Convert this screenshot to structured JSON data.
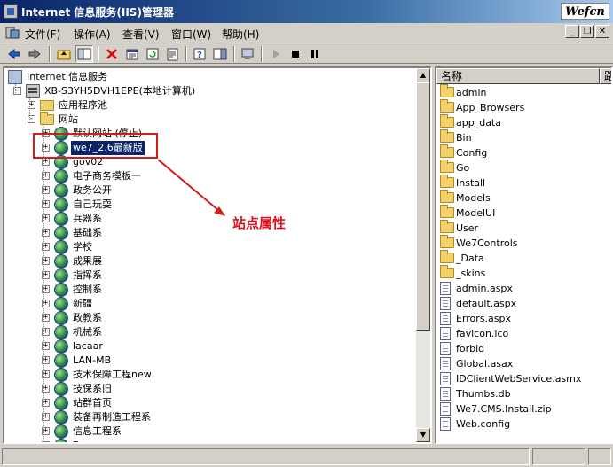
{
  "window": {
    "title": "Internet 信息服务(IIS)管理器",
    "watermark": "Wefcn"
  },
  "menu": [
    {
      "label": "文件(F)"
    },
    {
      "label": "操作(A)"
    },
    {
      "label": "查看(V)"
    },
    {
      "label": "窗口(W)"
    },
    {
      "label": "帮助(H)"
    }
  ],
  "tree": {
    "root": "Internet 信息服务",
    "server": "XB-S3YH5DVH1EPE(本地计算机)",
    "app_pools": "应用程序池",
    "websites": "网站",
    "sites": [
      {
        "label": "默认网站 (停止)"
      },
      {
        "label": "we7_2.6最新版"
      },
      {
        "label": "gov02"
      },
      {
        "label": "电子商务模板一"
      },
      {
        "label": "政务公开"
      },
      {
        "label": "自己玩耍"
      },
      {
        "label": "兵器系"
      },
      {
        "label": "基础系"
      },
      {
        "label": "学校"
      },
      {
        "label": "成果展"
      },
      {
        "label": "指挥系"
      },
      {
        "label": "控制系"
      },
      {
        "label": "新疆"
      },
      {
        "label": "政教系"
      },
      {
        "label": "机械系"
      },
      {
        "label": "lacaar"
      },
      {
        "label": "LAN-MB"
      },
      {
        "label": "技术保障工程new"
      },
      {
        "label": "技保系旧"
      },
      {
        "label": "站群首页"
      },
      {
        "label": "装备再制造工程系"
      },
      {
        "label": "信息工程系"
      },
      {
        "label": "Bona"
      }
    ]
  },
  "list": {
    "columns": [
      "名称",
      "路"
    ],
    "items": [
      {
        "name": "admin",
        "kind": "folder"
      },
      {
        "name": "App_Browsers",
        "kind": "folder"
      },
      {
        "name": "app_data",
        "kind": "folder"
      },
      {
        "name": "Bin",
        "kind": "folder"
      },
      {
        "name": "Config",
        "kind": "folder"
      },
      {
        "name": "Go",
        "kind": "folder"
      },
      {
        "name": "Install",
        "kind": "folder"
      },
      {
        "name": "Models",
        "kind": "folder"
      },
      {
        "name": "ModelUI",
        "kind": "folder"
      },
      {
        "name": "User",
        "kind": "folder"
      },
      {
        "name": "We7Controls",
        "kind": "folder"
      },
      {
        "name": "_Data",
        "kind": "folder"
      },
      {
        "name": "_skins",
        "kind": "folder"
      },
      {
        "name": "admin.aspx",
        "kind": "file"
      },
      {
        "name": "default.aspx",
        "kind": "file"
      },
      {
        "name": "Errors.aspx",
        "kind": "file"
      },
      {
        "name": "favicon.ico",
        "kind": "file"
      },
      {
        "name": "forbid",
        "kind": "file"
      },
      {
        "name": "Global.asax",
        "kind": "file"
      },
      {
        "name": "IDClientWebService.asmx",
        "kind": "file"
      },
      {
        "name": "Thumbs.db",
        "kind": "file"
      },
      {
        "name": "We7.CMS.Install.zip",
        "kind": "file"
      },
      {
        "name": "Web.config",
        "kind": "file"
      }
    ]
  },
  "annotation": {
    "text": "站点属性",
    "color": "#e0101e"
  },
  "colors": {
    "titlebar_start": "#0a246a",
    "selection": "#0a246a",
    "chrome": "#d4d0c8"
  }
}
